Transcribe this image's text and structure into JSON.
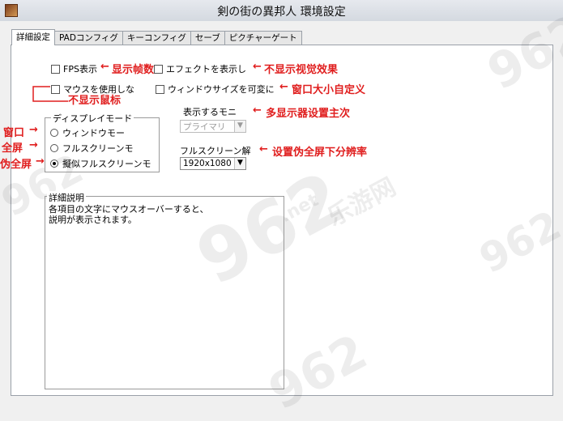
{
  "window": {
    "title": "剣の街の異邦人 環境設定"
  },
  "tabs": [
    {
      "label": "詳細設定",
      "active": true
    },
    {
      "label": "PADコンフィグ"
    },
    {
      "label": "キーコンフィグ"
    },
    {
      "label": "セーブ"
    },
    {
      "label": "ピクチャーゲート"
    }
  ],
  "options": {
    "fps": "FPS表示",
    "effects": "エフェクトを表示し",
    "mouse": "マウスを使用しな",
    "resize": "ウィンドウサイズを可変に"
  },
  "display_mode": {
    "legend": "ディスプレイモード",
    "window": "ウィンドウモー",
    "fullscreen": "フルスクリーンモ",
    "pseudo": "擬似フルスクリーンモ",
    "selected": "pseudo"
  },
  "monitor": {
    "label": "表示するモニ",
    "value": "プライマリ"
  },
  "resolution": {
    "label": "フルスクリーン解",
    "value": "1920x1080"
  },
  "description": {
    "legend": "詳細説明",
    "line1": "各項目の文字にマウスオーバーすると、",
    "line2": "説明が表示されます。"
  },
  "annotations": {
    "fps": "显示帧数",
    "effects": "不显示视觉效果",
    "mouse": "不显示鼠标",
    "resize": "窗口大小自定义",
    "monitor": "多显示器设置主次",
    "window_mode": "窗口",
    "fullscreen_mode": "全屏",
    "pseudo_mode": "伪全屏",
    "resolution": "设置伪全屏下分辨率"
  },
  "watermark": {
    "text": "962",
    "sub": "乐游网",
    "net": ".net"
  },
  "colors": {
    "annotation": "#e01e1e",
    "panel": "#ffffff",
    "window_bg": "#f0f0f0"
  }
}
